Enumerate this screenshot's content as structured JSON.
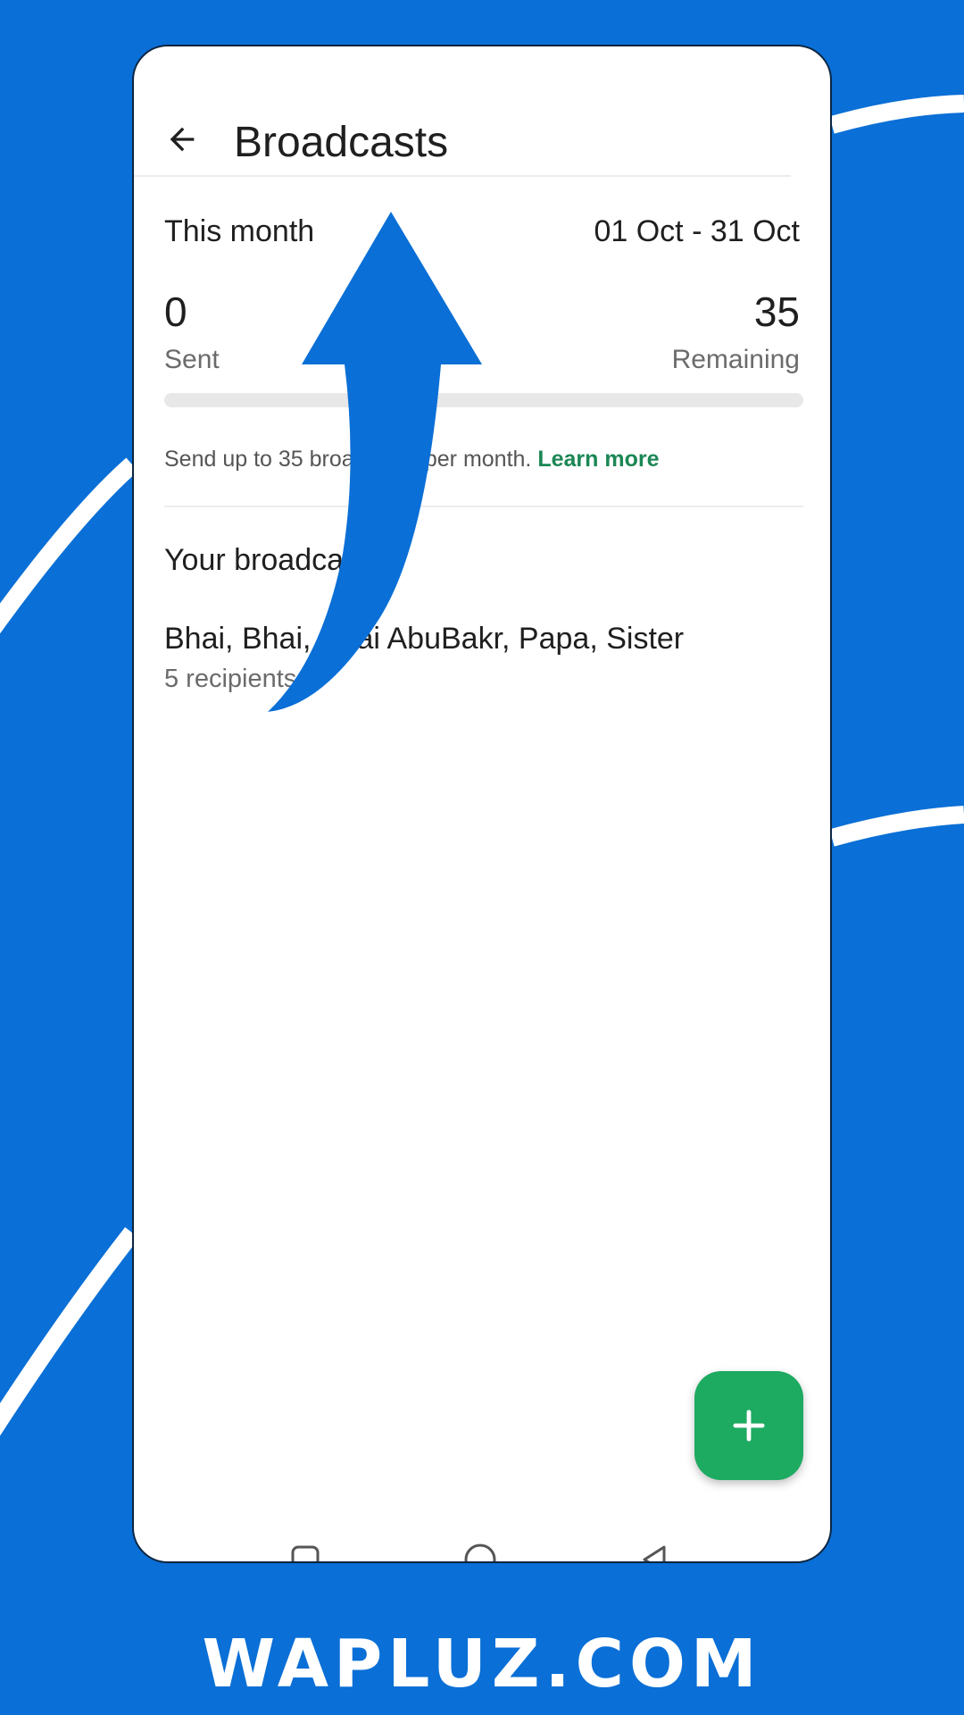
{
  "colors": {
    "background": "#0A6FD6",
    "accent_green": "#1DAA61",
    "link_green": "#1B8755",
    "overlay_arrow": "#0A6FD6"
  },
  "header": {
    "title": "Broadcasts",
    "back_icon": "arrow-left-icon"
  },
  "usage": {
    "period_label": "This month",
    "period_range": "01 Oct - 31 Oct",
    "sent_value": "0",
    "sent_label": "Sent",
    "remaining_value": "35",
    "remaining_label": "Remaining",
    "progress_fraction": 0
  },
  "info": {
    "text": "Send up to 35 broadcasts per month.",
    "link": "Learn more"
  },
  "broadcasts": {
    "section_title": "Your broadcasts",
    "items": [
      {
        "name": "Bhai, Bhai, Bhai AbuBakr, Papa, Sister",
        "recipients": "5 recipients"
      }
    ]
  },
  "fab": {
    "icon": "plus-icon"
  },
  "navbar": {
    "icons": [
      "recents-square-icon",
      "home-circle-icon",
      "back-triangle-icon"
    ]
  },
  "watermark": {
    "text": "WAPLUZ.COM"
  }
}
